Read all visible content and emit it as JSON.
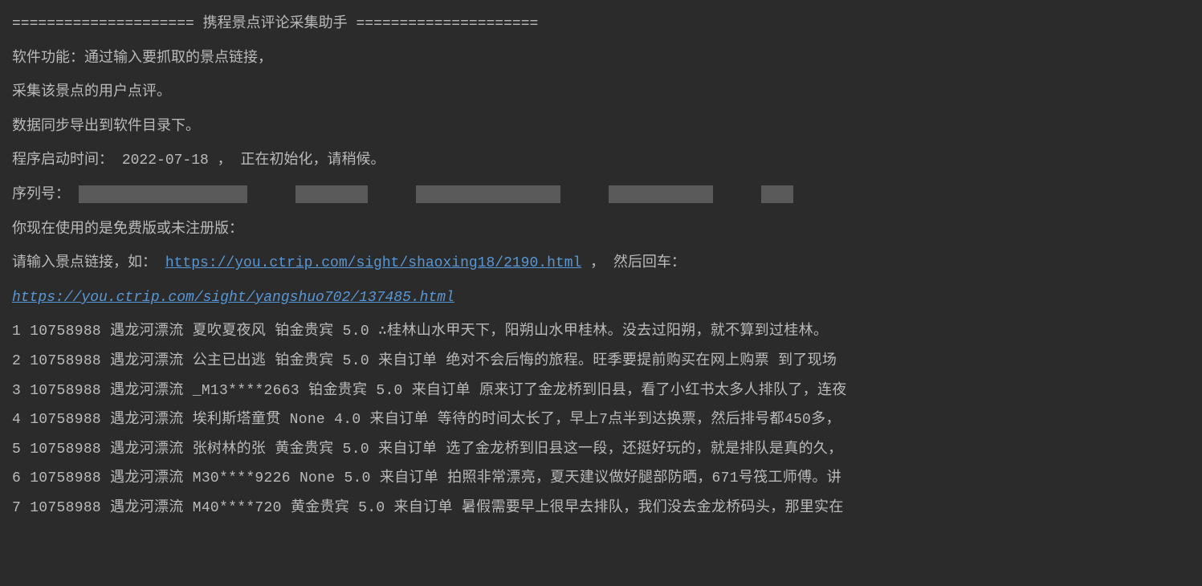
{
  "header": {
    "separator_left": "=====================",
    "title": "携程景点评论采集助手",
    "separator_right": "====================="
  },
  "intro": {
    "line1": "软件功能：通过输入要抓取的景点链接，",
    "line2": "采集该景点的用户点评。",
    "line3": "数据同步导出到软件目录下。",
    "line4_prefix": "程序启动时间：",
    "line4_date": "2022-07-18",
    "line4_suffix": "，  正在初始化，请稍候。",
    "line5_prefix": "序列号：",
    "line6": "你现在使用的是免费版或未注册版：",
    "line7_prefix": "请输入景点链接，如：",
    "line7_link": "https://you.ctrip.com/sight/shaoxing18/2190.html",
    "line7_suffix": "， 然后回车：",
    "input_url": "https://you.ctrip.com/sight/yangshuo702/137485.html"
  },
  "rows": [
    {
      "idx": "1",
      "id": "10758988",
      "spot": "遇龙河漂流",
      "user": "夏吹夏夜风",
      "level": "铂金贵宾",
      "score": "5.0",
      "source": "",
      "icon": "∴",
      "comment": "桂林山水甲天下，阳朔山水甲桂林。没去过阳朔，就不算到过桂林。"
    },
    {
      "idx": "2",
      "id": "10758988",
      "spot": "遇龙河漂流",
      "user": "公主已出逃",
      "level": "铂金贵宾",
      "score": "5.0",
      "source": "来自订单",
      "icon": "",
      "comment": "绝对不会后悔的旅程。旺季要提前购买在网上购票  到了现场"
    },
    {
      "idx": "3",
      "id": "10758988",
      "spot": "遇龙河漂流",
      "user": "_M13****2663",
      "level": "铂金贵宾",
      "score": "5.0",
      "source": "来自订单",
      "icon": "",
      "comment": "原来订了金龙桥到旧县，看了小红书太多人排队了，连夜"
    },
    {
      "idx": "4",
      "id": "10758988",
      "spot": "遇龙河漂流",
      "user": "埃利斯塔童贯",
      "level": "None",
      "score": "4.0",
      "source": "来自订单",
      "icon": "",
      "comment": "等待的时间太长了，早上7点半到达换票，然后排号都450多，"
    },
    {
      "idx": "5",
      "id": "10758988",
      "spot": "遇龙河漂流",
      "user": "张树林的张",
      "level": "黄金贵宾",
      "score": "5.0",
      "source": "来自订单",
      "icon": "",
      "comment": "选了金龙桥到旧县这一段，还挺好玩的，就是排队是真的久，"
    },
    {
      "idx": "6",
      "id": "10758988",
      "spot": "遇龙河漂流",
      "user": "M30****9226",
      "level": "None",
      "score": "5.0",
      "source": "来自订单",
      "icon": "",
      "comment": "拍照非常漂亮，夏天建议做好腿部防晒，671号筏工师傅。讲"
    },
    {
      "idx": "7",
      "id": "10758988",
      "spot": "遇龙河漂流",
      "user": "M40****720",
      "level": "黄金贵宾",
      "score": "5.0",
      "source": "来自订单",
      "icon": "",
      "comment": "暑假需要早上很早去排队，我们没去金龙桥码头，那里实在"
    }
  ]
}
